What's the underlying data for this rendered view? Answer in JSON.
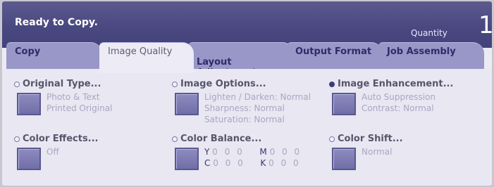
{
  "header": {
    "status": "Ready to Copy.",
    "quantity_label": "Quantity",
    "quantity_value": "1"
  },
  "tabs": [
    {
      "label": "Copy"
    },
    {
      "label": "Image Quality",
      "active": true
    },
    {
      "label": "Layout\nAdjustment"
    },
    {
      "label": "Output Format"
    },
    {
      "label": "Job Assembly"
    }
  ],
  "features": {
    "original_type": {
      "title": "Original Type...",
      "line1": "Photo & Text",
      "line2": "Printed Original"
    },
    "image_options": {
      "title": "Image Options...",
      "line1": "Lighten / Darken: Normal",
      "line2": "Sharpness: Normal",
      "line3": "Saturation: Normal"
    },
    "image_enhancement": {
      "title": "Image Enhancement...",
      "line1": "Auto Suppression",
      "line2": "Contrast: Normal"
    },
    "color_effects": {
      "title": "Color Effects...",
      "line1": "Off"
    },
    "color_balance": {
      "title": "Color Balance...",
      "y_label": "Y",
      "y_values": "0 0 0",
      "m_label": "M",
      "m_values": "0 0 0",
      "c_label": "C",
      "c_values": "0 0 0",
      "k_label": "K",
      "k_values": "0 0 0"
    },
    "color_shift": {
      "title": "Color Shift...",
      "line1": "Normal"
    }
  }
}
